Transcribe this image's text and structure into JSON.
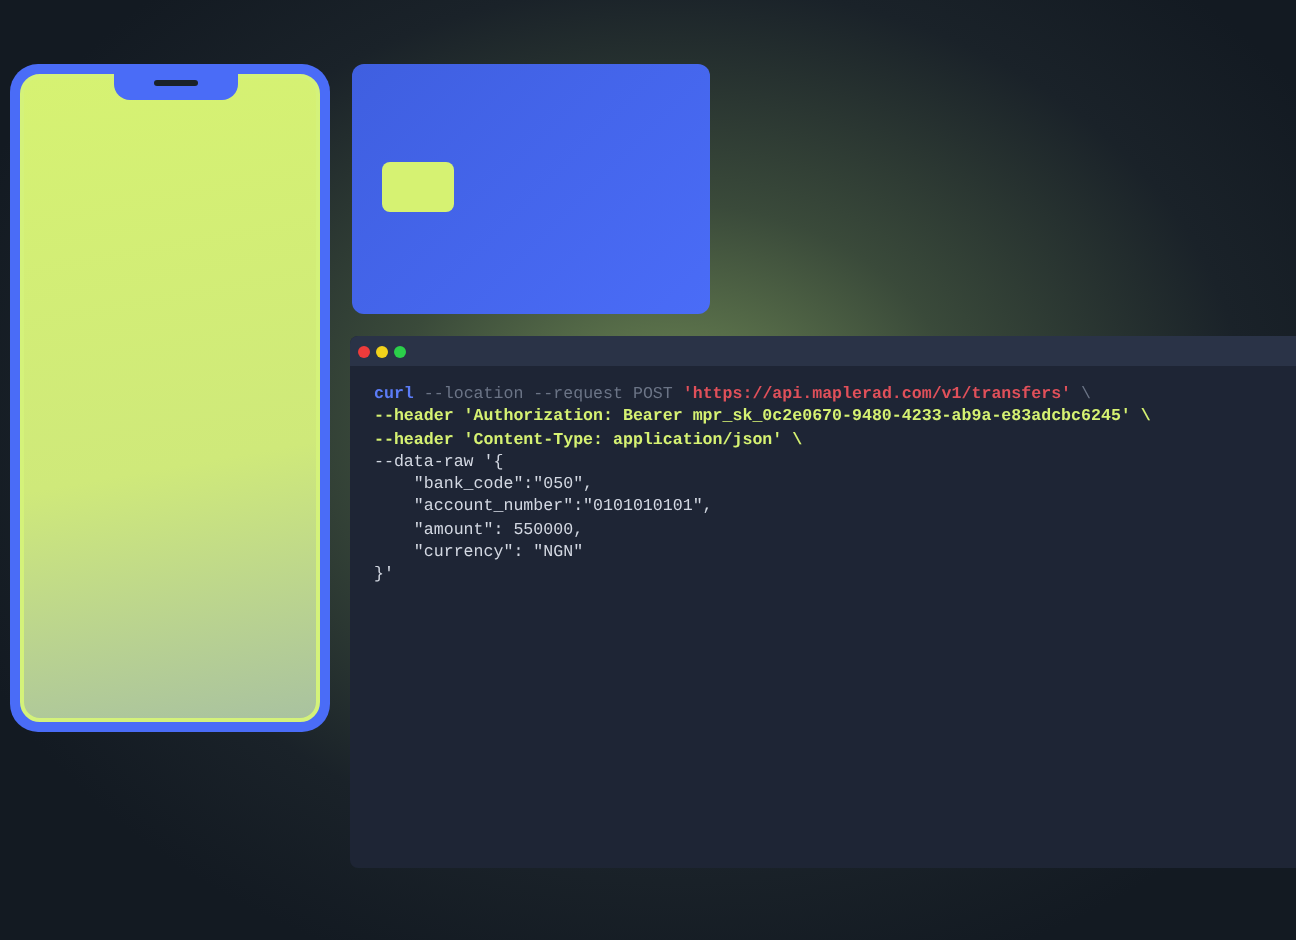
{
  "terminal": {
    "lines": [
      [
        {
          "kind": "cmd",
          "text": "curl"
        },
        {
          "kind": "flag",
          "text": " --location --request POST "
        },
        {
          "kind": "url",
          "text": "'https://api.maplerad.com/v1/transfers'"
        },
        {
          "kind": "flag",
          "text": " \\"
        }
      ],
      [
        {
          "kind": "header",
          "text": "--header 'Authorization: Bearer mpr_sk_0c2e0670-9480-4233-ab9a-e83adcbc6245' \\"
        }
      ],
      [
        {
          "kind": "header",
          "text": "--header 'Content-Type: application/json' \\"
        }
      ],
      [
        {
          "kind": "body",
          "text": "--data-raw '{"
        }
      ],
      [
        {
          "kind": "body",
          "text": "    \"bank_code\":\"050\","
        }
      ],
      [
        {
          "kind": "body",
          "text": "    \"account_number\":\"0101010101\","
        }
      ],
      [
        {
          "kind": "body",
          "text": "    \"amount\": 550000,"
        }
      ],
      [
        {
          "kind": "body",
          "text": "    \"currency\": \"NGN\""
        }
      ],
      [
        {
          "kind": "body",
          "text": "}'"
        }
      ]
    ]
  }
}
